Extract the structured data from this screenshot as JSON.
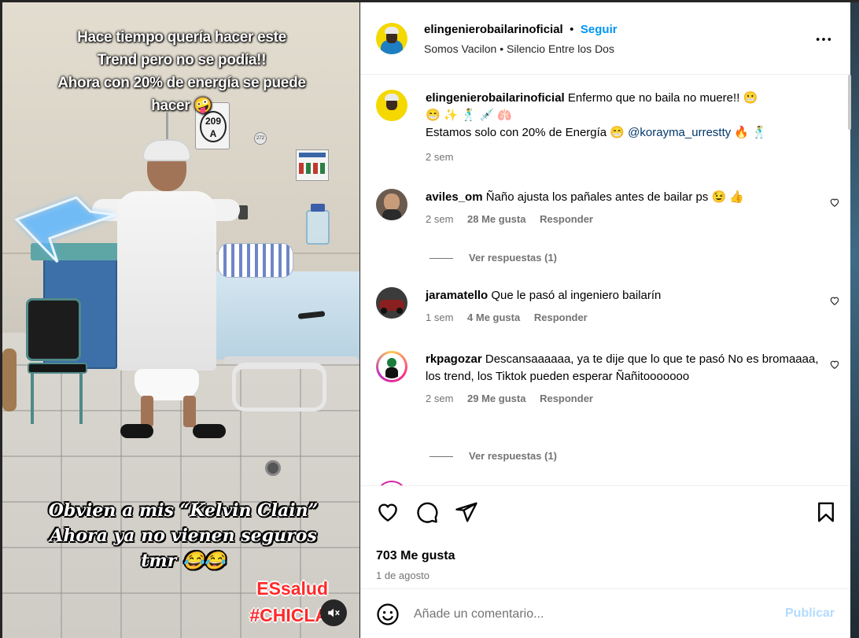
{
  "media": {
    "caption_top": [
      "Hace tiempo quería hacer este",
      "Trend pero no se podía!!",
      "Ahora con 20% de energía se puede",
      "hacer 🤪"
    ],
    "caption_mid": [
      "Obvien a mis “Kelvin Clain”",
      "Ahora ya no vienen seguros",
      "tmr 😂😂"
    ],
    "tag": [
      "ESsalud",
      "#CHICLA"
    ],
    "room_sign": [
      "209",
      "A"
    ],
    "door_sign": "272",
    "mute_icon": "speaker-muted-icon"
  },
  "header": {
    "username": "elingenierobailarinoficial",
    "separator": "•",
    "follow_label": "Seguir",
    "audio": "Somos Vacilon • Silencio Entre los Dos",
    "more_icon": "more-options-icon"
  },
  "caption": {
    "username": "elingenierobailarinoficial",
    "line1": "Enfermo que no baila no muere!! 😬",
    "line2": "😁 ✨ 🕺 💉 🫁",
    "line3_prefix": "Estamos solo con 20% de Energía 😁 ",
    "mention": "@korayma_urrestty",
    "line3_suffix": " 🔥 🕺",
    "time": "2 sem"
  },
  "comments": [
    {
      "username": "aviles_om",
      "text": "Ñaño ajusta los pañales antes de bailar ps 😉 👍",
      "time": "2 sem",
      "likes": "28 Me gusta",
      "reply": "Responder",
      "replies": "Ver respuestas (1)"
    },
    {
      "username": "jaramatello",
      "text": "Que le pasó al ingeniero bailarín",
      "time": "1 sem",
      "likes": "4 Me gusta",
      "reply": "Responder"
    },
    {
      "username": "rkpagozar",
      "text": "Descansaaaaaa, ya te dije que lo que te pasó No es bromaaaa, los trend, los Tiktok pueden esperar Ñañitooooooo",
      "time": "2 sem",
      "likes": "29 Me gusta",
      "reply": "Responder",
      "replies": "Ver respuestas (1)"
    }
  ],
  "actions": {
    "icons": [
      "heart-icon",
      "comment-icon",
      "share-icon",
      "bookmark-icon"
    ],
    "likes": "703 Me gusta",
    "date": "1 de agosto"
  },
  "composer": {
    "placeholder": "Añade un comentario...",
    "publish_label": "Publicar",
    "emoji_icon": "emoji-icon"
  },
  "colors": {
    "accent": "#0095f6",
    "publish_disabled": "#b3dbff",
    "muted_text": "#737373",
    "tag_red": "#ff2a2a"
  }
}
